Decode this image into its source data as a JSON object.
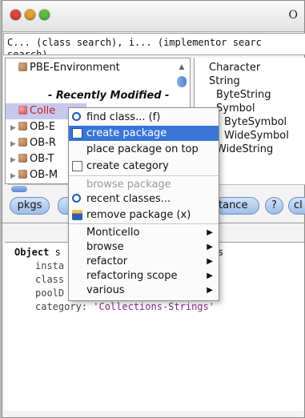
{
  "window": {
    "title": "O"
  },
  "search": {
    "line1": "C... (class search), i... (implementor searc",
    "line2": "search)"
  },
  "packages": {
    "items": [
      {
        "label": "PBE-Environment",
        "expand": "",
        "icon": "package-icon"
      },
      {
        "label": "- Recently Modified -",
        "expand": "",
        "icon": ""
      },
      {
        "label": "Colle",
        "expand": "",
        "icon": "package-icon"
      },
      {
        "label": "OB-E",
        "expand": "▶",
        "icon": "package-icon"
      },
      {
        "label": "OB-R",
        "expand": "▶",
        "icon": "package-icon"
      },
      {
        "label": "OB-T",
        "expand": "▶",
        "icon": "package-icon"
      },
      {
        "label": "OB-M",
        "expand": "▶",
        "icon": "package-icon"
      }
    ]
  },
  "classes": {
    "items": [
      "Character",
      "String",
      "ByteString",
      "Symbol",
      "ByteSymbol",
      "WideSymbol",
      "WideString"
    ]
  },
  "toolbar": {
    "pkgs": "pkgs",
    "instance": "tance",
    "help": "?",
    "class": "cl"
  },
  "code": {
    "line1_kw": "Object",
    "line1_rest": " s",
    "line1_tail": "s",
    "line2": "insta",
    "line3": "class",
    "line4": "poolD",
    "line5_key": "category: ",
    "line5_val": "'Collections-Strings'"
  },
  "menu": {
    "items": [
      {
        "label": "find class... (f)",
        "icon": "magnifier-icon"
      },
      {
        "label": "create package",
        "icon": "new-package-icon",
        "selected": true
      },
      {
        "label": "place package on top",
        "icon": ""
      },
      {
        "label": "create category",
        "icon": "new-category-icon"
      },
      {
        "label": "browse package",
        "icon": "",
        "disabled": true
      },
      {
        "label": "recent classes...",
        "icon": "magnifier-icon"
      },
      {
        "label": "remove package (x)",
        "icon": "trash-icon"
      },
      {
        "label": "Monticello",
        "submenu": true
      },
      {
        "label": "browse",
        "submenu": true
      },
      {
        "label": "refactor",
        "submenu": true
      },
      {
        "label": "refactoring scope",
        "submenu": true
      },
      {
        "label": "various",
        "submenu": true
      }
    ]
  },
  "colors": {
    "selection": "#3875d7",
    "close": "#e0443e",
    "minimize": "#e5a02a",
    "zoom": "#5fbe45",
    "string_literal": "#8b2a8b"
  }
}
